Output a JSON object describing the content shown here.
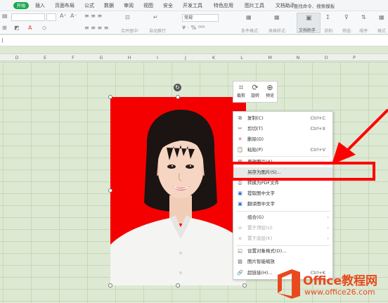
{
  "menubar": {
    "start": "开始",
    "tabs": [
      "插入",
      "页面布局",
      "公式",
      "数据",
      "审阅",
      "视图",
      "安全",
      "开发工具",
      "特色应用",
      "图片工具",
      "文档助手"
    ],
    "search": "查找命令、搜索模板"
  },
  "ribbon": {
    "number_format": "常规",
    "labels": {
      "merge": "合并居中·",
      "wrap": "自动换行",
      "cond": "条件格式·",
      "table_style": "表格样式·",
      "doc_helper": "文档助手",
      "sum": "求和·",
      "filter": "筛选·",
      "sort": "排序·",
      "format": "格式"
    }
  },
  "columns": [
    "D",
    "E",
    "F",
    "G",
    "H",
    "I",
    "J",
    "K",
    "L",
    "M",
    "N",
    "O",
    "P"
  ],
  "minitoolbar": {
    "crop": "裁剪",
    "rotate": "旋转",
    "preview": "预览"
  },
  "context_menu": {
    "copy": "复制(C)",
    "copy_sc": "Ctrl+C",
    "cut": "剪切(T)",
    "cut_sc": "Ctrl+X",
    "delete": "删除(D)",
    "paste": "粘贴(P)",
    "paste_sc": "Ctrl+V",
    "change_pic": "更改图片(A)",
    "save_as_pic": "另存为图片(S)...",
    "to_pdf": "转换为PDF文件",
    "extract_text": "提取图中文字",
    "translate_text": "翻译图中文字",
    "combine": "组合(G)",
    "bring_top": "置于顶层(U)",
    "send_bottom": "置于底层(K)",
    "format_obj": "设置对象格式(O)...",
    "smart_scale": "图片智能缩放",
    "hyperlink": "超链接(H)...",
    "hyperlink_sc": "Ctrl+K"
  },
  "watermark": {
    "brand": "Office教程网",
    "url": "www.office26.com"
  },
  "colors": {
    "accent_green": "#19a84d",
    "photo_red": "#f50000",
    "highlight_red": "#ff0000",
    "office_orange": "#e8491e"
  }
}
